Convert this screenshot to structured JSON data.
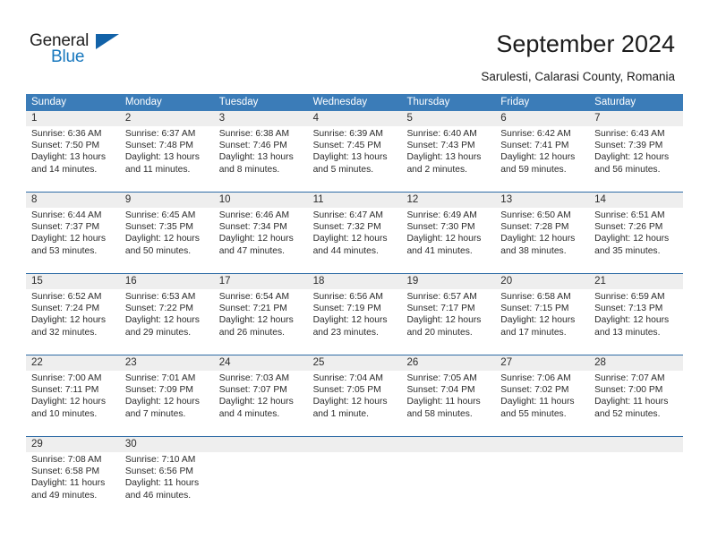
{
  "brand": {
    "name_part1": "General",
    "name_part2": "Blue",
    "triangle_color": "#1262a8",
    "blue_color": "#1878be"
  },
  "header": {
    "title": "September 2024",
    "subtitle": "Sarulesti, Calarasi County, Romania"
  },
  "theme": {
    "header_row_bg": "#3b7cb8",
    "week_separator": "#2f6ca6",
    "day_band_bg": "#eeeeee",
    "text_color": "#2b2b2b"
  },
  "weekdays": [
    "Sunday",
    "Monday",
    "Tuesday",
    "Wednesday",
    "Thursday",
    "Friday",
    "Saturday"
  ],
  "weeks": [
    [
      {
        "day": "1",
        "sunrise": "Sunrise: 6:36 AM",
        "sunset": "Sunset: 7:50 PM",
        "daylight1": "Daylight: 13 hours",
        "daylight2": "and 14 minutes."
      },
      {
        "day": "2",
        "sunrise": "Sunrise: 6:37 AM",
        "sunset": "Sunset: 7:48 PM",
        "daylight1": "Daylight: 13 hours",
        "daylight2": "and 11 minutes."
      },
      {
        "day": "3",
        "sunrise": "Sunrise: 6:38 AM",
        "sunset": "Sunset: 7:46 PM",
        "daylight1": "Daylight: 13 hours",
        "daylight2": "and 8 minutes."
      },
      {
        "day": "4",
        "sunrise": "Sunrise: 6:39 AM",
        "sunset": "Sunset: 7:45 PM",
        "daylight1": "Daylight: 13 hours",
        "daylight2": "and 5 minutes."
      },
      {
        "day": "5",
        "sunrise": "Sunrise: 6:40 AM",
        "sunset": "Sunset: 7:43 PM",
        "daylight1": "Daylight: 13 hours",
        "daylight2": "and 2 minutes."
      },
      {
        "day": "6",
        "sunrise": "Sunrise: 6:42 AM",
        "sunset": "Sunset: 7:41 PM",
        "daylight1": "Daylight: 12 hours",
        "daylight2": "and 59 minutes."
      },
      {
        "day": "7",
        "sunrise": "Sunrise: 6:43 AM",
        "sunset": "Sunset: 7:39 PM",
        "daylight1": "Daylight: 12 hours",
        "daylight2": "and 56 minutes."
      }
    ],
    [
      {
        "day": "8",
        "sunrise": "Sunrise: 6:44 AM",
        "sunset": "Sunset: 7:37 PM",
        "daylight1": "Daylight: 12 hours",
        "daylight2": "and 53 minutes."
      },
      {
        "day": "9",
        "sunrise": "Sunrise: 6:45 AM",
        "sunset": "Sunset: 7:35 PM",
        "daylight1": "Daylight: 12 hours",
        "daylight2": "and 50 minutes."
      },
      {
        "day": "10",
        "sunrise": "Sunrise: 6:46 AM",
        "sunset": "Sunset: 7:34 PM",
        "daylight1": "Daylight: 12 hours",
        "daylight2": "and 47 minutes."
      },
      {
        "day": "11",
        "sunrise": "Sunrise: 6:47 AM",
        "sunset": "Sunset: 7:32 PM",
        "daylight1": "Daylight: 12 hours",
        "daylight2": "and 44 minutes."
      },
      {
        "day": "12",
        "sunrise": "Sunrise: 6:49 AM",
        "sunset": "Sunset: 7:30 PM",
        "daylight1": "Daylight: 12 hours",
        "daylight2": "and 41 minutes."
      },
      {
        "day": "13",
        "sunrise": "Sunrise: 6:50 AM",
        "sunset": "Sunset: 7:28 PM",
        "daylight1": "Daylight: 12 hours",
        "daylight2": "and 38 minutes."
      },
      {
        "day": "14",
        "sunrise": "Sunrise: 6:51 AM",
        "sunset": "Sunset: 7:26 PM",
        "daylight1": "Daylight: 12 hours",
        "daylight2": "and 35 minutes."
      }
    ],
    [
      {
        "day": "15",
        "sunrise": "Sunrise: 6:52 AM",
        "sunset": "Sunset: 7:24 PM",
        "daylight1": "Daylight: 12 hours",
        "daylight2": "and 32 minutes."
      },
      {
        "day": "16",
        "sunrise": "Sunrise: 6:53 AM",
        "sunset": "Sunset: 7:22 PM",
        "daylight1": "Daylight: 12 hours",
        "daylight2": "and 29 minutes."
      },
      {
        "day": "17",
        "sunrise": "Sunrise: 6:54 AM",
        "sunset": "Sunset: 7:21 PM",
        "daylight1": "Daylight: 12 hours",
        "daylight2": "and 26 minutes."
      },
      {
        "day": "18",
        "sunrise": "Sunrise: 6:56 AM",
        "sunset": "Sunset: 7:19 PM",
        "daylight1": "Daylight: 12 hours",
        "daylight2": "and 23 minutes."
      },
      {
        "day": "19",
        "sunrise": "Sunrise: 6:57 AM",
        "sunset": "Sunset: 7:17 PM",
        "daylight1": "Daylight: 12 hours",
        "daylight2": "and 20 minutes."
      },
      {
        "day": "20",
        "sunrise": "Sunrise: 6:58 AM",
        "sunset": "Sunset: 7:15 PM",
        "daylight1": "Daylight: 12 hours",
        "daylight2": "and 17 minutes."
      },
      {
        "day": "21",
        "sunrise": "Sunrise: 6:59 AM",
        "sunset": "Sunset: 7:13 PM",
        "daylight1": "Daylight: 12 hours",
        "daylight2": "and 13 minutes."
      }
    ],
    [
      {
        "day": "22",
        "sunrise": "Sunrise: 7:00 AM",
        "sunset": "Sunset: 7:11 PM",
        "daylight1": "Daylight: 12 hours",
        "daylight2": "and 10 minutes."
      },
      {
        "day": "23",
        "sunrise": "Sunrise: 7:01 AM",
        "sunset": "Sunset: 7:09 PM",
        "daylight1": "Daylight: 12 hours",
        "daylight2": "and 7 minutes."
      },
      {
        "day": "24",
        "sunrise": "Sunrise: 7:03 AM",
        "sunset": "Sunset: 7:07 PM",
        "daylight1": "Daylight: 12 hours",
        "daylight2": "and 4 minutes."
      },
      {
        "day": "25",
        "sunrise": "Sunrise: 7:04 AM",
        "sunset": "Sunset: 7:05 PM",
        "daylight1": "Daylight: 12 hours",
        "daylight2": "and 1 minute."
      },
      {
        "day": "26",
        "sunrise": "Sunrise: 7:05 AM",
        "sunset": "Sunset: 7:04 PM",
        "daylight1": "Daylight: 11 hours",
        "daylight2": "and 58 minutes."
      },
      {
        "day": "27",
        "sunrise": "Sunrise: 7:06 AM",
        "sunset": "Sunset: 7:02 PM",
        "daylight1": "Daylight: 11 hours",
        "daylight2": "and 55 minutes."
      },
      {
        "day": "28",
        "sunrise": "Sunrise: 7:07 AM",
        "sunset": "Sunset: 7:00 PM",
        "daylight1": "Daylight: 11 hours",
        "daylight2": "and 52 minutes."
      }
    ],
    [
      {
        "day": "29",
        "sunrise": "Sunrise: 7:08 AM",
        "sunset": "Sunset: 6:58 PM",
        "daylight1": "Daylight: 11 hours",
        "daylight2": "and 49 minutes."
      },
      {
        "day": "30",
        "sunrise": "Sunrise: 7:10 AM",
        "sunset": "Sunset: 6:56 PM",
        "daylight1": "Daylight: 11 hours",
        "daylight2": "and 46 minutes."
      },
      {
        "day": "",
        "sunrise": "",
        "sunset": "",
        "daylight1": "",
        "daylight2": ""
      },
      {
        "day": "",
        "sunrise": "",
        "sunset": "",
        "daylight1": "",
        "daylight2": ""
      },
      {
        "day": "",
        "sunrise": "",
        "sunset": "",
        "daylight1": "",
        "daylight2": ""
      },
      {
        "day": "",
        "sunrise": "",
        "sunset": "",
        "daylight1": "",
        "daylight2": ""
      },
      {
        "day": "",
        "sunrise": "",
        "sunset": "",
        "daylight1": "",
        "daylight2": ""
      }
    ]
  ]
}
